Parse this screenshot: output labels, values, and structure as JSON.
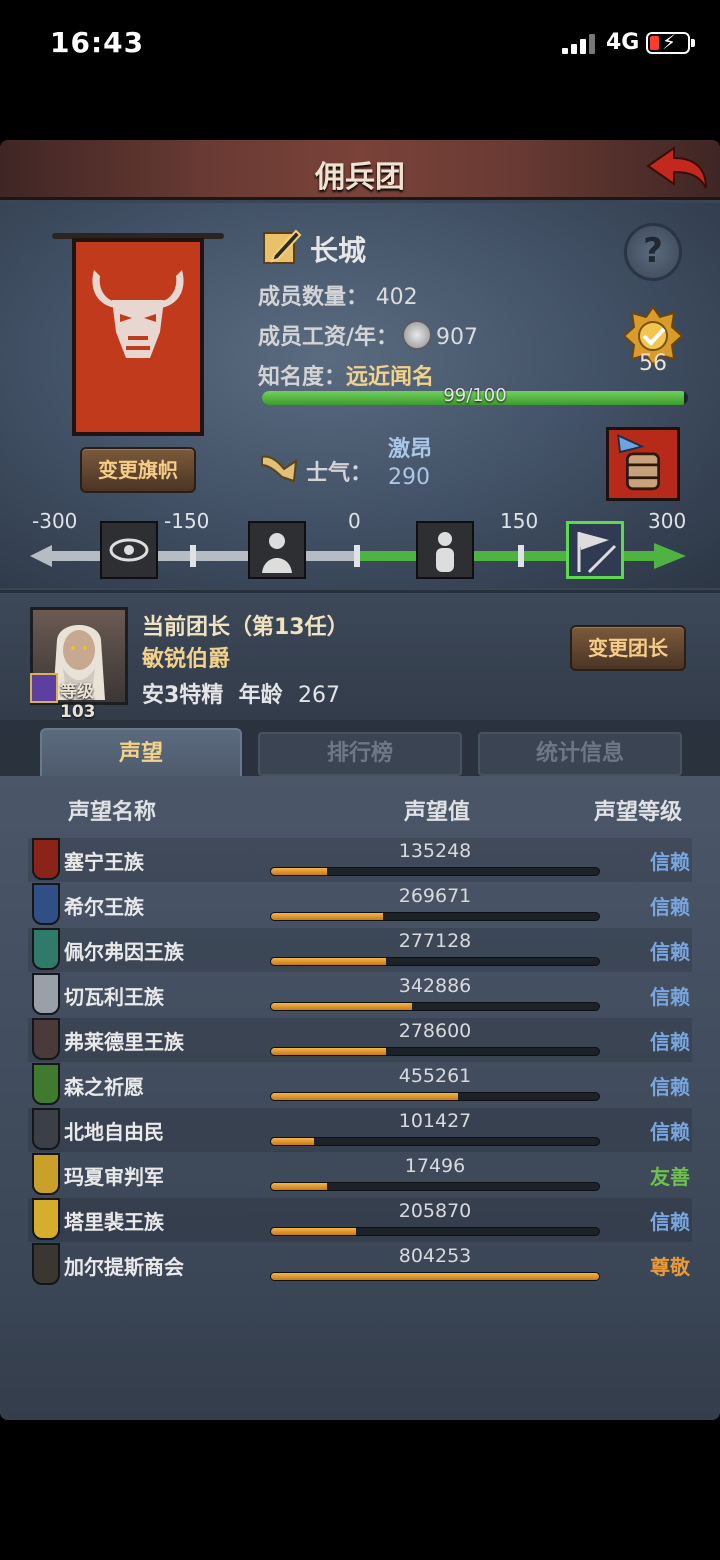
{
  "status": {
    "time": "16:43",
    "network": "4G"
  },
  "header": {
    "title": "佣兵团"
  },
  "guild": {
    "name": "长城",
    "help": "?",
    "members_label": "成员数量：",
    "members": "402",
    "wage_label": "成员工资/年：",
    "wage": "907",
    "fame_label": "知名度：",
    "fame": "远近闻名",
    "fame_progress_text": "99/100",
    "fame_progress": 0.99,
    "medal_value": "56",
    "change_banner": "变更旗帜",
    "morale_label": "士气：",
    "morale_state": "激昂",
    "morale_value": "290",
    "scale_labels": [
      "-300",
      "-150",
      "0",
      "150",
      "300"
    ]
  },
  "leader": {
    "title": "当前团长（第13任）",
    "name": "敏锐伯爵",
    "level": "等级103",
    "traits": "安3特精",
    "age_label": "年龄",
    "age": "267",
    "change": "变更团长"
  },
  "tabs": [
    "声望",
    "排行榜",
    "统计信息"
  ],
  "table": {
    "headers": [
      "声望名称",
      "声望值",
      "声望等级"
    ],
    "rows": [
      {
        "name": "塞宁王族",
        "value": "135248",
        "progress": 0.17,
        "level": "信赖",
        "icon": "#8a2418",
        "levelColor": "#7aa6e0"
      },
      {
        "name": "希尔王族",
        "value": "269671",
        "progress": 0.34,
        "level": "信赖",
        "icon": "#2f4f86",
        "levelColor": "#7aa6e0"
      },
      {
        "name": "佩尔弗因王族",
        "value": "277128",
        "progress": 0.35,
        "level": "信赖",
        "icon": "#2f7a6a",
        "levelColor": "#7aa6e0"
      },
      {
        "name": "切瓦利王族",
        "value": "342886",
        "progress": 0.43,
        "level": "信赖",
        "icon": "#9aa0a8",
        "levelColor": "#7aa6e0"
      },
      {
        "name": "弗莱德里王族",
        "value": "278600",
        "progress": 0.35,
        "level": "信赖",
        "icon": "#4a3a3a",
        "levelColor": "#7aa6e0"
      },
      {
        "name": "森之祈愿",
        "value": "455261",
        "progress": 0.57,
        "level": "信赖",
        "icon": "#3f7a2e",
        "levelColor": "#7aa6e0"
      },
      {
        "name": "北地自由民",
        "value": "101427",
        "progress": 0.13,
        "level": "信赖",
        "icon": "#3b3f47",
        "levelColor": "#7aa6e0"
      },
      {
        "name": "玛夏审判军",
        "value": "17496",
        "progress": 0.17,
        "level": "友善",
        "icon": "#c9a12a",
        "levelColor": "#6fc04f"
      },
      {
        "name": "塔里裴王族",
        "value": "205870",
        "progress": 0.26,
        "level": "信赖",
        "icon": "#d6ae2c",
        "levelColor": "#7aa6e0"
      },
      {
        "name": "加尔提斯商会",
        "value": "804253",
        "progress": 1.0,
        "level": "尊敬",
        "icon": "#3a3631",
        "levelColor": "#e89a3a"
      }
    ]
  }
}
